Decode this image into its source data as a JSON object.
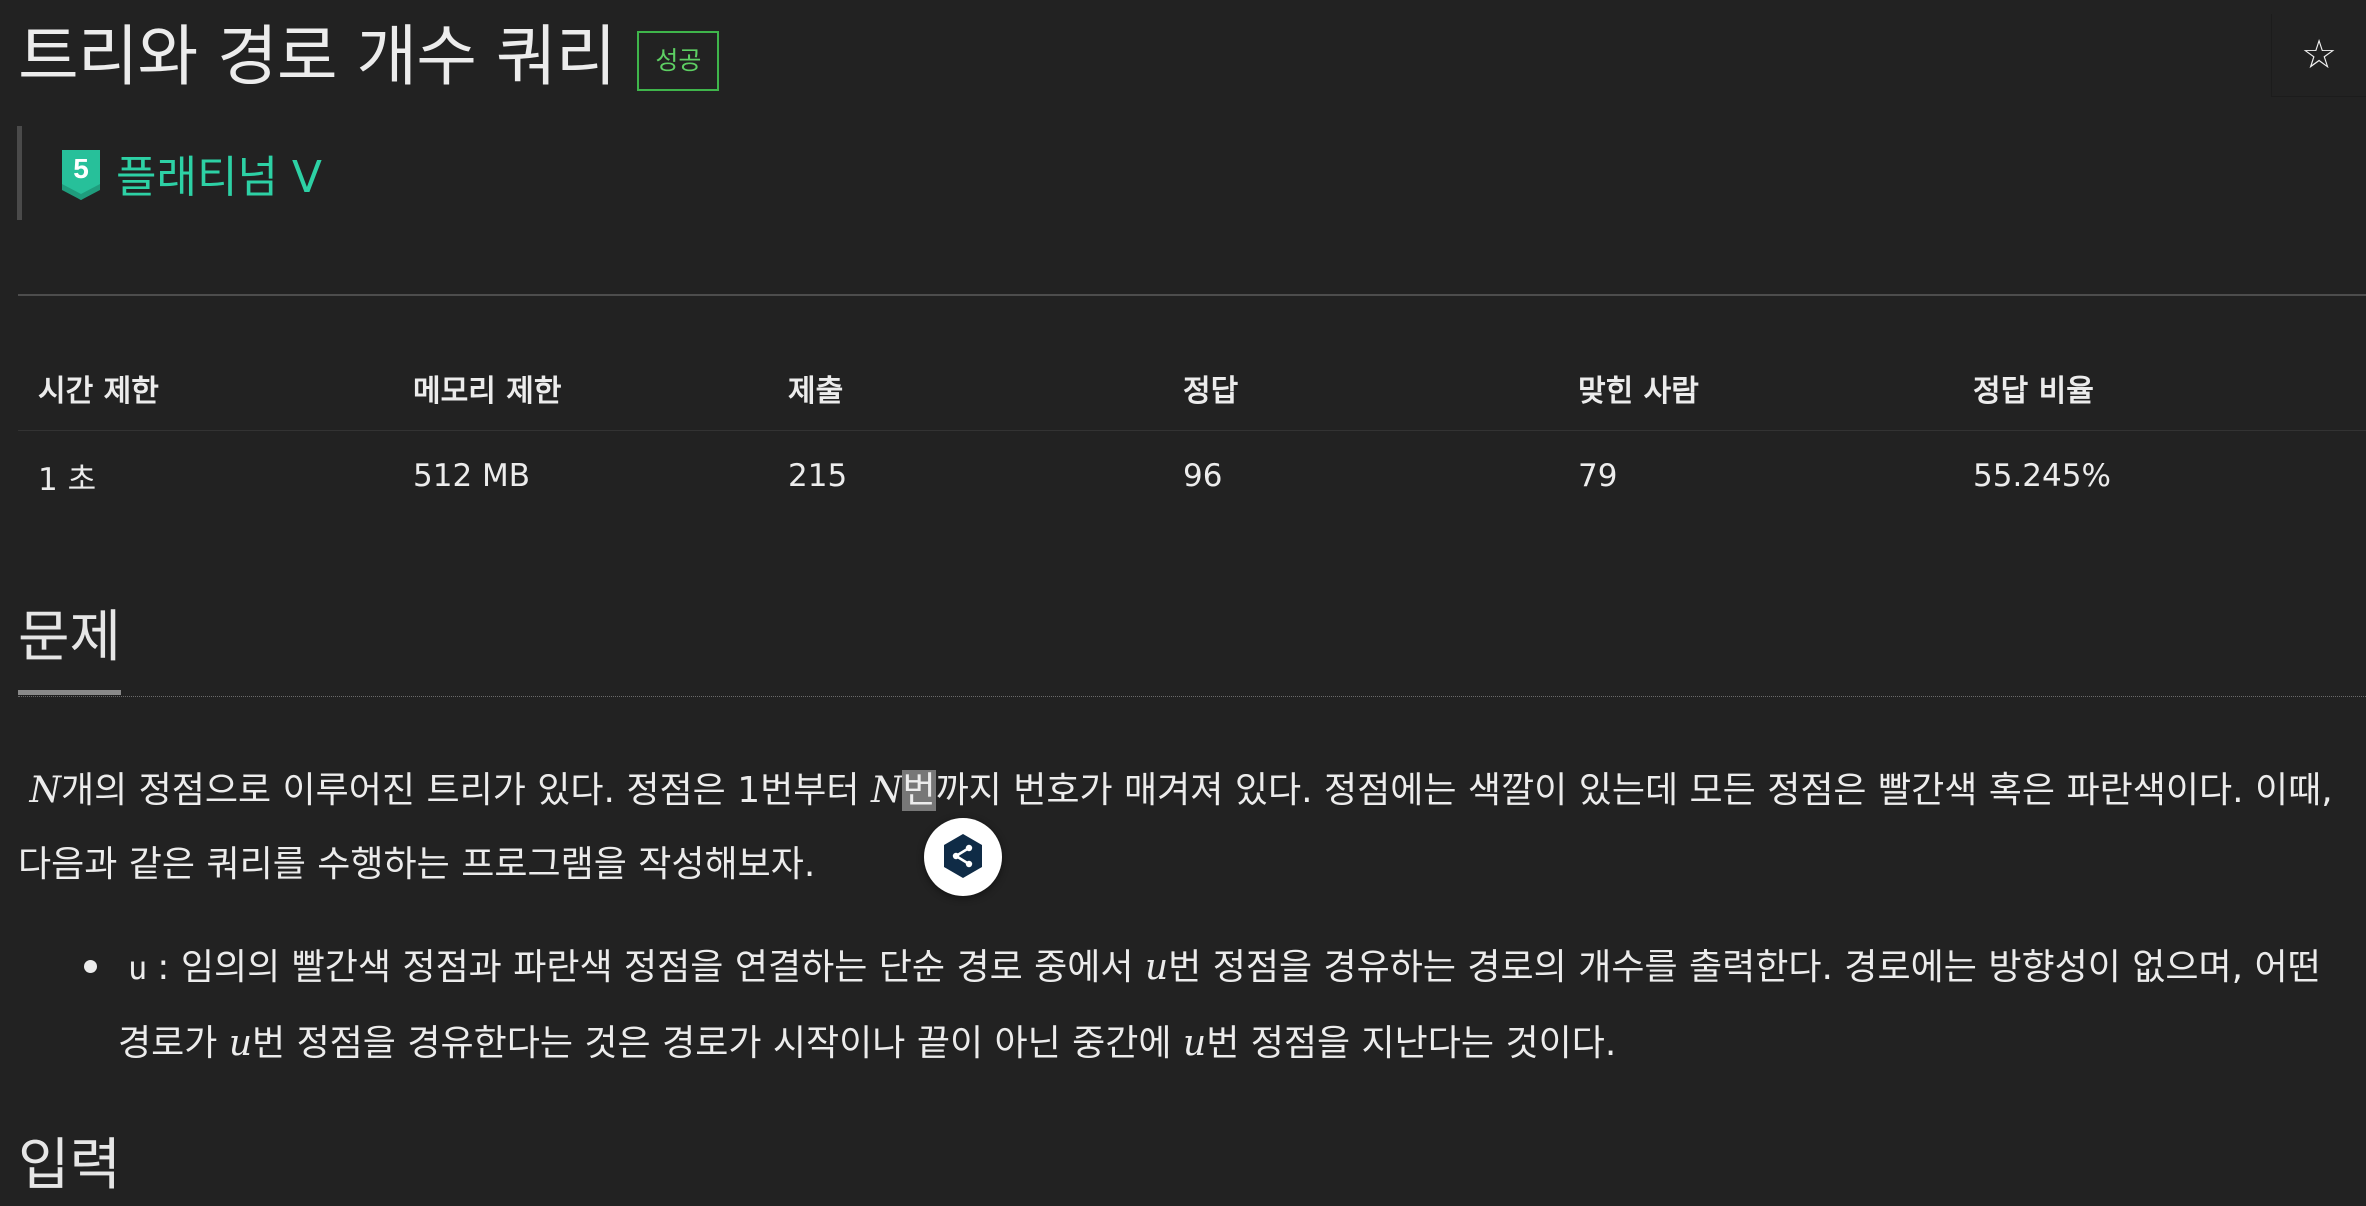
{
  "header": {
    "title": "트리와 경로 개수 쿼리",
    "result_badge": "성공",
    "star_icon": "☆"
  },
  "tier": {
    "level_number": "5",
    "label": "플래티넘 V",
    "color": "#2dd1a5"
  },
  "info_table": {
    "headers": [
      "시간 제한",
      "메모리 제한",
      "제출",
      "정답",
      "맞힌 사람",
      "정답 비율"
    ],
    "values": [
      "1 초",
      "512 MB",
      "215",
      "96",
      "79",
      "55.245%"
    ]
  },
  "problem": {
    "section_title": "문제",
    "var_N": "N",
    "text_1": "개의 정점으로 이루어진 트리가 있다. 정점은 1번부터 ",
    "highlighted": "번",
    "text_2": "까지 번호가 매겨져 있다. 정점에는 색깔이 있는데 모든 정점은 빨간색 혹은 파란색이다. 이때, 다음과 같은 쿼리를 수행하는 프로그램을 작성해보자.",
    "query_code": "u",
    "query_text_1": ": 임의의 빨간색 정점과 파란색 정점을 연결하는 단순 경로 중에서 ",
    "var_u": "u",
    "query_text_2": "번 정점을 경유하는 경로의 개수를 출력한다. 경로에는 방향성이 없으며, 어떤 경로가 ",
    "query_text_3": "번 정점을 경유한다는 것은 경로가 시작이나 끝이 아닌 중간에 ",
    "query_text_4": "번 정점을 지난다는 것이다."
  },
  "input_section": {
    "title": "입력"
  },
  "colors": {
    "background": "#222222",
    "success": "#3fb54b",
    "tier": "#2dd1a5"
  }
}
